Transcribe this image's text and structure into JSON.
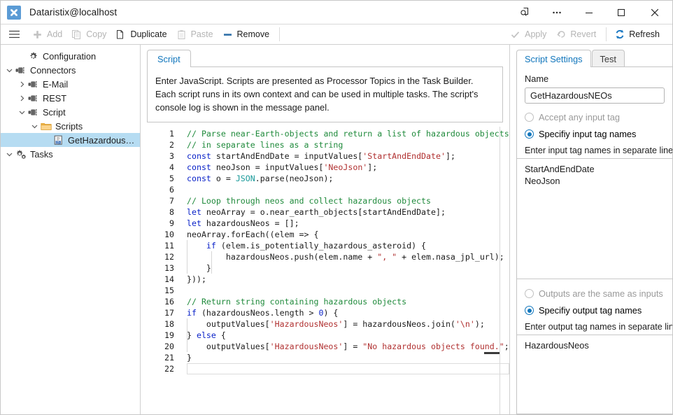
{
  "window": {
    "title": "Dataristix@localhost",
    "app_icon": "app-x-icon",
    "controls": {
      "search": "search-page-icon",
      "more": "…",
      "minimize": "—",
      "maximize": "▢",
      "close": "✕"
    }
  },
  "toolbar": {
    "menu_label": "menu-icon",
    "items": [
      {
        "label": "Add",
        "icon": "plus-icon",
        "enabled": false
      },
      {
        "label": "Copy",
        "icon": "copy-icon",
        "enabled": false
      },
      {
        "label": "Duplicate",
        "icon": "duplicate-icon",
        "enabled": true
      },
      {
        "label": "Paste",
        "icon": "paste-icon",
        "enabled": false
      },
      {
        "label": "Remove",
        "icon": "minus-icon",
        "enabled": true
      }
    ],
    "right_items": [
      {
        "label": "Apply",
        "icon": "check-icon",
        "enabled": false
      },
      {
        "label": "Revert",
        "icon": "undo-icon",
        "enabled": false
      },
      {
        "label": "Refresh",
        "icon": "refresh-icon",
        "enabled": true
      }
    ]
  },
  "sidebar": {
    "items": [
      {
        "label": "Configuration",
        "icon": "gear-icon",
        "indent": 1,
        "chevron": "none",
        "selected": false
      },
      {
        "label": "Connectors",
        "icon": "plug-icon",
        "indent": 0,
        "chevron": "down",
        "selected": false
      },
      {
        "label": "E-Mail",
        "icon": "plug-icon",
        "indent": 1,
        "chevron": "right",
        "selected": false
      },
      {
        "label": "REST",
        "icon": "plug-icon",
        "indent": 1,
        "chevron": "right",
        "selected": false
      },
      {
        "label": "Script",
        "icon": "plug-icon",
        "indent": 1,
        "chevron": "down",
        "selected": false
      },
      {
        "label": "Scripts",
        "icon": "folder-icon",
        "indent": 2,
        "chevron": "down",
        "selected": false
      },
      {
        "label": "GetHazardousNEOs",
        "icon": "js-file-icon",
        "indent": 3,
        "chevron": "none",
        "selected": true
      },
      {
        "label": "Tasks",
        "icon": "tasks-gears-icon",
        "indent": 0,
        "chevron": "down",
        "selected": false
      }
    ]
  },
  "center": {
    "tab_label": "Script",
    "description": "Enter JavaScript. Scripts are presented as Processor Topics in the Task Builder. Each script runs in its own context and can be used in multiple tasks. The script's console log is shown in the message panel.",
    "editor": {
      "line_numbers": [
        1,
        2,
        3,
        4,
        5,
        6,
        7,
        8,
        9,
        10,
        11,
        12,
        13,
        14,
        15,
        16,
        17,
        18,
        19,
        20,
        21,
        22
      ],
      "active_line": 22,
      "lines": [
        {
          "n": 1,
          "tokens": [
            {
              "t": "// Parse near-Earth-objects and return a list of hazardous objects",
              "c": "com"
            }
          ]
        },
        {
          "n": 2,
          "tokens": [
            {
              "t": "// in separate lines as a string",
              "c": "com"
            }
          ]
        },
        {
          "n": 3,
          "tokens": [
            {
              "t": "const",
              "c": "kw"
            },
            {
              "t": " startAndEndDate = inputValues[",
              "c": "pun"
            },
            {
              "t": "'StartAndEndDate'",
              "c": "str"
            },
            {
              "t": "];",
              "c": "pun"
            }
          ]
        },
        {
          "n": 4,
          "tokens": [
            {
              "t": "const",
              "c": "kw"
            },
            {
              "t": " neoJson = inputValues[",
              "c": "pun"
            },
            {
              "t": "'NeoJson'",
              "c": "str"
            },
            {
              "t": "];",
              "c": "pun"
            }
          ]
        },
        {
          "n": 5,
          "tokens": [
            {
              "t": "const",
              "c": "kw"
            },
            {
              "t": " o = ",
              "c": "pun"
            },
            {
              "t": "JSON",
              "c": "cls"
            },
            {
              "t": ".parse(neoJson);",
              "c": "pun"
            }
          ]
        },
        {
          "n": 6,
          "tokens": []
        },
        {
          "n": 7,
          "tokens": [
            {
              "t": "// Loop through neos and collect hazardous objects",
              "c": "com"
            }
          ]
        },
        {
          "n": 8,
          "tokens": [
            {
              "t": "let",
              "c": "kw"
            },
            {
              "t": " neoArray = o.near_earth_objects[startAndEndDate];",
              "c": "pun"
            }
          ]
        },
        {
          "n": 9,
          "tokens": [
            {
              "t": "let",
              "c": "kw"
            },
            {
              "t": " hazardousNeos = [];",
              "c": "pun"
            }
          ]
        },
        {
          "n": 10,
          "tokens": [
            {
              "t": "neoArray.forEach((elem => {",
              "c": "pun"
            }
          ]
        },
        {
          "n": 11,
          "tokens": [
            {
              "t": "    ",
              "c": "pun"
            },
            {
              "t": "if",
              "c": "kw"
            },
            {
              "t": " (elem.is_potentially_hazardous_asteroid) {",
              "c": "pun"
            }
          ]
        },
        {
          "n": 12,
          "tokens": [
            {
              "t": "        hazardousNeos.push(elem.name + ",
              "c": "pun"
            },
            {
              "t": "\", \"",
              "c": "str"
            },
            {
              "t": " + elem.nasa_jpl_url);",
              "c": "pun"
            }
          ]
        },
        {
          "n": 13,
          "tokens": [
            {
              "t": "    }",
              "c": "pun"
            }
          ]
        },
        {
          "n": 14,
          "tokens": [
            {
              "t": "}));",
              "c": "pun"
            }
          ]
        },
        {
          "n": 15,
          "tokens": []
        },
        {
          "n": 16,
          "tokens": [
            {
              "t": "// Return string containing hazardous objects",
              "c": "com"
            }
          ]
        },
        {
          "n": 17,
          "tokens": [
            {
              "t": "if",
              "c": "kw"
            },
            {
              "t": " (hazardousNeos.length > ",
              "c": "pun"
            },
            {
              "t": "0",
              "c": "num"
            },
            {
              "t": ") {",
              "c": "pun"
            }
          ]
        },
        {
          "n": 18,
          "tokens": [
            {
              "t": "    outputValues[",
              "c": "pun"
            },
            {
              "t": "'HazardousNeos'",
              "c": "str"
            },
            {
              "t": "] = hazardousNeos.join(",
              "c": "pun"
            },
            {
              "t": "'\\n'",
              "c": "str"
            },
            {
              "t": ");",
              "c": "pun"
            }
          ]
        },
        {
          "n": 19,
          "tokens": [
            {
              "t": "} ",
              "c": "pun"
            },
            {
              "t": "else",
              "c": "kw"
            },
            {
              "t": " {",
              "c": "pun"
            }
          ]
        },
        {
          "n": 20,
          "tokens": [
            {
              "t": "    outputValues[",
              "c": "pun"
            },
            {
              "t": "'HazardousNeos'",
              "c": "str"
            },
            {
              "t": "] = ",
              "c": "pun"
            },
            {
              "t": "\"No hazardous objects found.\"",
              "c": "str"
            },
            {
              "t": ";",
              "c": "pun"
            }
          ]
        },
        {
          "n": 21,
          "tokens": [
            {
              "t": "}",
              "c": "pun"
            }
          ]
        },
        {
          "n": 22,
          "tokens": []
        }
      ]
    }
  },
  "right_panel": {
    "tabs": [
      {
        "label": "Script Settings",
        "active": true
      },
      {
        "label": "Test",
        "active": false
      }
    ],
    "name_label": "Name",
    "name_value": "GetHazardousNEOs",
    "input_radio_any": "Accept any input tag",
    "input_radio_specify": "Specifiy input tag names",
    "input_selected": "specify",
    "input_hint": "Enter input tag names in separate lines",
    "input_tags": [
      "StartAndEndDate",
      "NeoJson"
    ],
    "output_radio_same": "Outputs are the same as inputs",
    "output_radio_specify": "Specifiy output tag names",
    "output_selected": "specify",
    "output_hint": "Enter output tag names in separate lines",
    "output_tags": [
      "HazardousNeos"
    ]
  },
  "colors": {
    "accent": "#1176bc",
    "selection": "#b6dcf2",
    "app_icon_bg": "#5b9bd5",
    "comment": "#1f8a3b",
    "keyword": "#0a22c8",
    "string": "#b03030",
    "class": "#1a9a9a"
  }
}
